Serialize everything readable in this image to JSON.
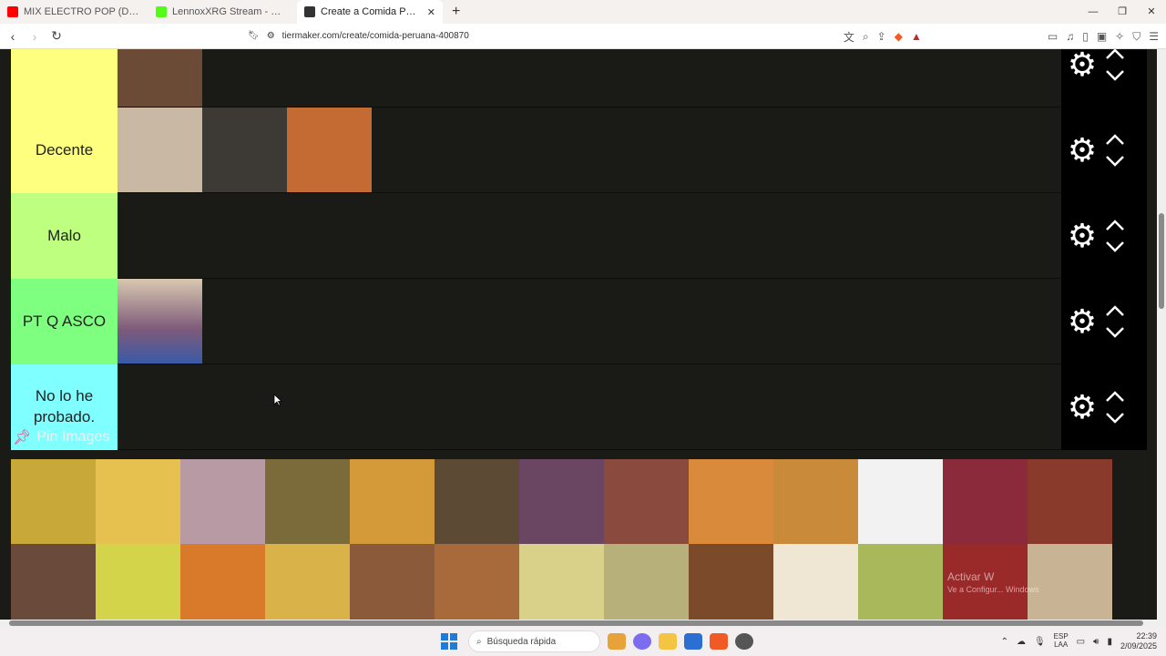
{
  "tabs": [
    {
      "title": "MIX ELECTRO POP (DAVID GUET",
      "favicon_color": "#ff0000"
    },
    {
      "title": "LennoxXRG Stream - Watch Live on K",
      "favicon_color": "#53fc18"
    },
    {
      "title": "Create a Comida Peruana Tier Li",
      "favicon_color": "#333333"
    }
  ],
  "url": "tiermaker.com/create/comida-peruana-400870",
  "tiers": [
    {
      "label": "",
      "color": "#ffff7f",
      "items": [
        {
          "color": "#6b4a36"
        }
      ]
    },
    {
      "label": "Decente",
      "color": "#ffff7f",
      "items": [
        {
          "color": "#c9b8a4"
        },
        {
          "color": "#3d3a36"
        },
        {
          "color": "#c36b33"
        }
      ]
    },
    {
      "label": "Malo",
      "color": "#bfff7f",
      "items": []
    },
    {
      "label": "PT Q ASCO",
      "color": "#7fff7f",
      "items": [
        {
          "color": "#7d5a7a"
        }
      ]
    },
    {
      "label": "No lo he probado.",
      "color": "#7fffff",
      "items": []
    }
  ],
  "pin_section": {
    "title": "Pin Images"
  },
  "pin_images": [
    {
      "color": "#c9a83a"
    },
    {
      "color": "#e7c14f"
    },
    {
      "color": "#b89aa4"
    },
    {
      "color": "#7b6a3a"
    },
    {
      "color": "#d49a3a"
    },
    {
      "color": "#5c4a34"
    },
    {
      "color": "#6a4662"
    },
    {
      "color": "#8b4a3e"
    },
    {
      "color": "#d98a3a"
    },
    {
      "color": "#c98a3a"
    },
    {
      "color": "#f2f2f2"
    },
    {
      "color": "#8a2a3a"
    },
    {
      "color": "#8a3a2a"
    },
    {
      "color": "#6a4a3a"
    },
    {
      "color": "#d4d44a"
    },
    {
      "color": "#d97a2a"
    },
    {
      "color": "#d9b24a"
    },
    {
      "color": "#8a5a3a"
    },
    {
      "color": "#a86a3a"
    },
    {
      "color": "#d9d08a"
    },
    {
      "color": "#b8b07a"
    },
    {
      "color": "#7a4a2a"
    },
    {
      "color": "#efe6d4"
    },
    {
      "color": "#a9b85a"
    },
    {
      "color": "#9a2a2a"
    },
    {
      "color": "#c8b494"
    }
  ],
  "watermark": {
    "line1": "Activar W",
    "line2": "Ve a Configur... Windows"
  },
  "taskbar": {
    "search_placeholder": "Búsqueda rápida",
    "lang_top": "ESP",
    "lang_bottom": "LAA",
    "time": "22:39",
    "date": "2/09/2025"
  }
}
